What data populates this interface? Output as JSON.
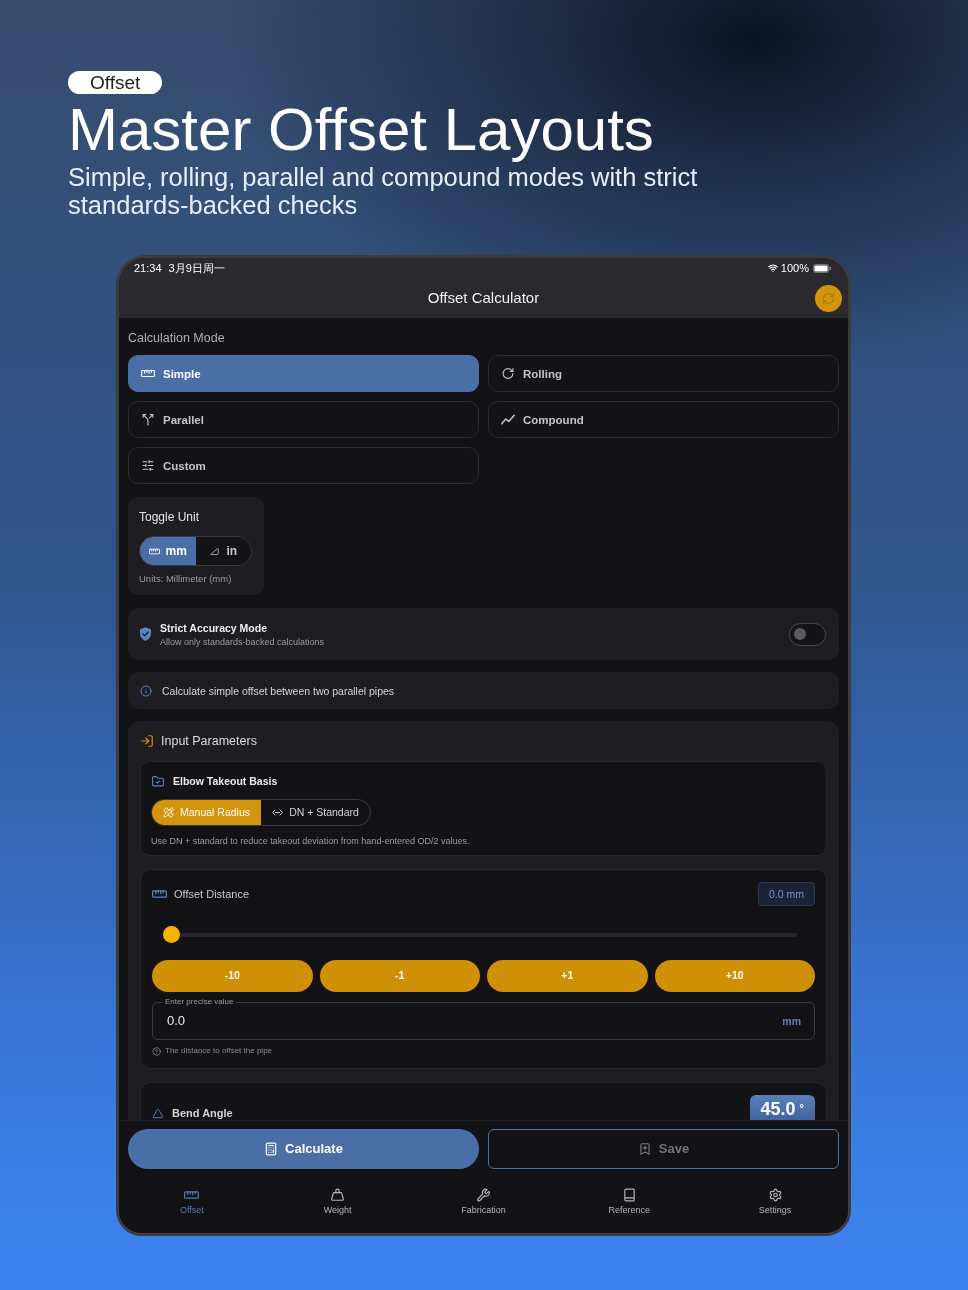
{
  "hero": {
    "badge": "Offset",
    "title": "Master Offset Layouts",
    "subtitle": "Simple, rolling, parallel and compound modes with strict standards-backed checks"
  },
  "status_bar": {
    "time": "21:34",
    "date": "3月9日周一",
    "battery": "100%"
  },
  "header": {
    "title": "Offset Calculator"
  },
  "calculation_mode": {
    "label": "Calculation Mode",
    "modes": [
      {
        "label": "Simple",
        "selected": true
      },
      {
        "label": "Rolling",
        "selected": false
      },
      {
        "label": "Parallel",
        "selected": false
      },
      {
        "label": "Compound",
        "selected": false
      },
      {
        "label": "Custom",
        "selected": false
      }
    ]
  },
  "unit_toggle": {
    "title": "Toggle Unit",
    "options": [
      {
        "label": "mm",
        "selected": true
      },
      {
        "label": "in",
        "selected": false
      }
    ],
    "caption": "Units: Millimeter (mm)"
  },
  "strict_mode": {
    "title": "Strict Accuracy Mode",
    "subtitle": "Allow only standards-backed calculations",
    "on": false
  },
  "info": {
    "text": "Calculate simple offset between two parallel pipes"
  },
  "input_parameters": {
    "title": "Input Parameters",
    "elbow_takeout": {
      "title": "Elbow Takeout Basis",
      "options": [
        {
          "label": "Manual Radius",
          "selected": true
        },
        {
          "label": "DN + Standard",
          "selected": false
        }
      ],
      "note": "Use DN + standard to reduce takeout deviation from hand-entered OD/2 values."
    },
    "offset_distance": {
      "title": "Offset Distance",
      "readout": "0.0 mm",
      "slider": {
        "level": 0
      },
      "steps": [
        "-10",
        "-1",
        "+1",
        "+10"
      ],
      "field": {
        "label": "Enter precise value",
        "value": "0.0",
        "unit": "mm"
      },
      "hint": "The distance to offset the pipe"
    },
    "bend_angle": {
      "title": "Bend Angle",
      "value": "45.0",
      "unit": "°"
    }
  },
  "actions": [
    {
      "label": "Calculate",
      "kind": "primary",
      "disabled": false
    },
    {
      "label": "Save",
      "kind": "outline",
      "disabled": true
    }
  ],
  "tab_bar": [
    {
      "label": "Offset",
      "selected": true
    },
    {
      "label": "Weight",
      "selected": false
    },
    {
      "label": "Fabrication",
      "selected": false
    },
    {
      "label": "Reference",
      "selected": false
    },
    {
      "label": "Settings",
      "selected": false
    }
  ]
}
